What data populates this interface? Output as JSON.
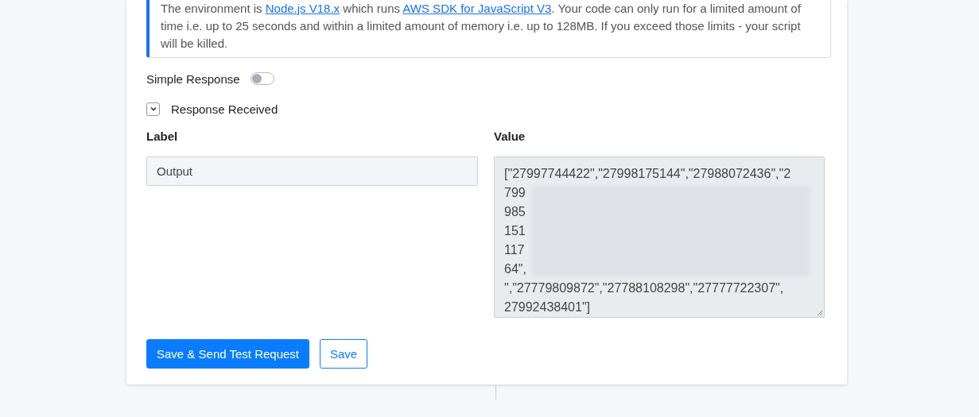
{
  "notice": {
    "parts": [
      {
        "kind": "text",
        "text": "The environment is "
      },
      {
        "kind": "link",
        "text": "Node.js V18.x"
      },
      {
        "kind": "text",
        "text": " which runs "
      },
      {
        "kind": "link",
        "text": "AWS SDK for JavaScript V3"
      },
      {
        "kind": "text",
        "text": ". Your code can only run for a limited amount of time i.e. up to 25 seconds and within a limited amount of memory i.e. up to 128MB. If you exceed those limits - your script will be killed."
      }
    ]
  },
  "simple_response": {
    "label": "Simple Response",
    "on": false
  },
  "response_received": {
    "label": "Response Received",
    "expanded": true
  },
  "columns": {
    "label": "Label",
    "value": "Value"
  },
  "output_label": "Output",
  "value_lines": [
    "[\"27997744422\",\"27998175144\",\"27988072436\",\"2",
    "799",
    "985",
    "151",
    "117",
    "64\",",
    "\",\"27779809872\",\"27788108298\",\"27777722307\",",
    "27992438401\"]"
  ],
  "buttons": [
    {
      "kind": "primary",
      "label": "Save & Send Test Request"
    },
    {
      "kind": "outline",
      "label": "Save"
    }
  ]
}
